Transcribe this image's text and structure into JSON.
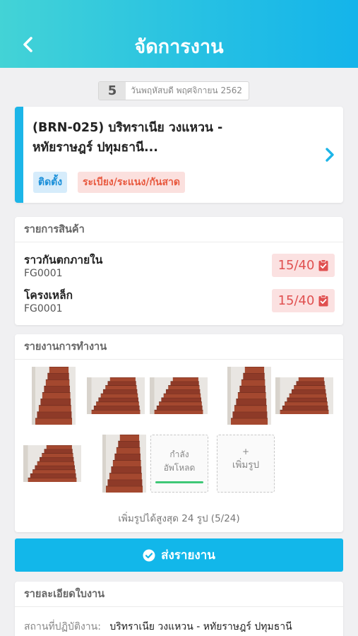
{
  "header": {
    "title": "จัดการงาน",
    "back_icon": "chevron-left-icon"
  },
  "date": {
    "day": "5",
    "text": "วันพฤหัสบดี พฤศจิกายน 2562"
  },
  "job": {
    "title_line1": "(BRN-025) บริทราเนีย วงแหวน -",
    "title_line2": "หทัยราษฎร์ ปทุมธานี...",
    "tags": [
      "ติดตั้ง",
      "ระเบียง/ระแนง/กันสาด"
    ],
    "accent_color": "#1cb5e8"
  },
  "products": {
    "heading": "รายการสินค้า",
    "items": [
      {
        "name": "ราวกันตกภายใน",
        "code": "FG0001",
        "count": "15/40"
      },
      {
        "name": "โครงเหล็ก",
        "code": "FG0001",
        "count": "15/40"
      }
    ]
  },
  "report": {
    "heading": "รายงานการทำงาน",
    "photo_count": 7,
    "uploading_line1": "กำลัง",
    "uploading_line2": "อัพโหลด",
    "add_plus": "+",
    "add_label": "เพิ่มรูป",
    "limit_text": "เพิ่มรูปได้สูงสุด 24 รูป (5/24)"
  },
  "submit": {
    "label": "ส่งรายงาน",
    "icon": "check-circle-icon",
    "color": "#12b7ea"
  },
  "details": {
    "heading": "รายละเอียดใบงาน",
    "location_label": "สถานที่ปฏิบัติงาน:",
    "location_value": "บริทราเนีย วงแหวน - หทัยราษฎร์ ปทุมธานี"
  }
}
